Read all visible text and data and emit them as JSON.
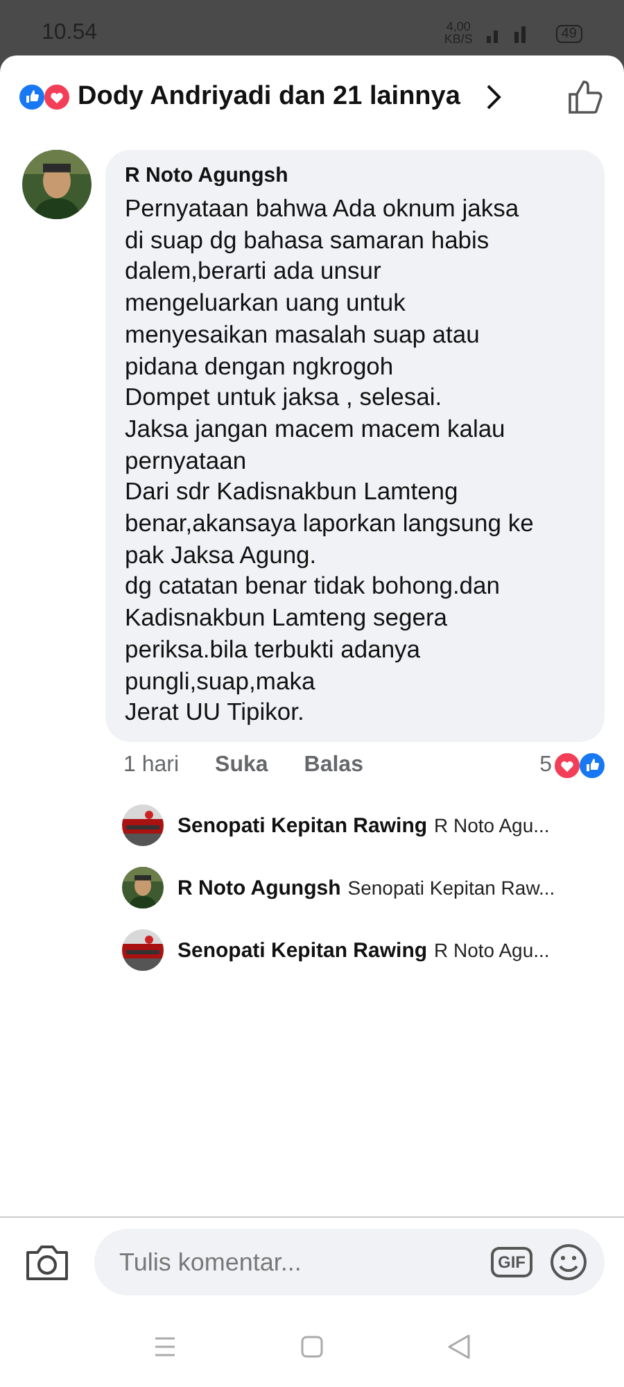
{
  "status_bar": {
    "time": "10.54",
    "speed": "4,00",
    "speed_unit": "KB/S",
    "battery": "49"
  },
  "header": {
    "reactions_text": "Dody Andriyadi dan 21 lainnya"
  },
  "comment": {
    "author": "R Noto Agungsh",
    "text": "Pernyataan bahwa Ada oknum jaksa\ndi suap dg bahasa samaran habis\ndalem,berarti ada unsur\nmengeluarkan uang untuk\nmenyesaikan masalah suap atau\npidana dengan ngkrogoh\nDompet untuk jaksa , selesai.\nJaksa jangan macem macem kalau\npernyataan\nDari sdr Kadisnakbun Lamteng\nbenar,akansaya laporkan langsung ke\npak Jaksa Agung.\ndg catatan benar tidak bohong.dan\nKadisnakbun Lamteng segera\nperiksa.bila terbukti adanya\npungli,suap,maka\nJerat UU Tipikor.",
    "time": "1 hari",
    "like": "Suka",
    "reply": "Balas",
    "reaction_count": "5"
  },
  "replies": [
    {
      "author": "Senopati Kepitan Rawing",
      "preview": "R Noto Agu..."
    },
    {
      "author": "R Noto Agungsh",
      "preview": "Senopati Kepitan Raw..."
    },
    {
      "author": "Senopati Kepitan Rawing",
      "preview": "R Noto Agu..."
    }
  ],
  "composer": {
    "placeholder": "Tulis komentar...",
    "gif": "GIF"
  }
}
